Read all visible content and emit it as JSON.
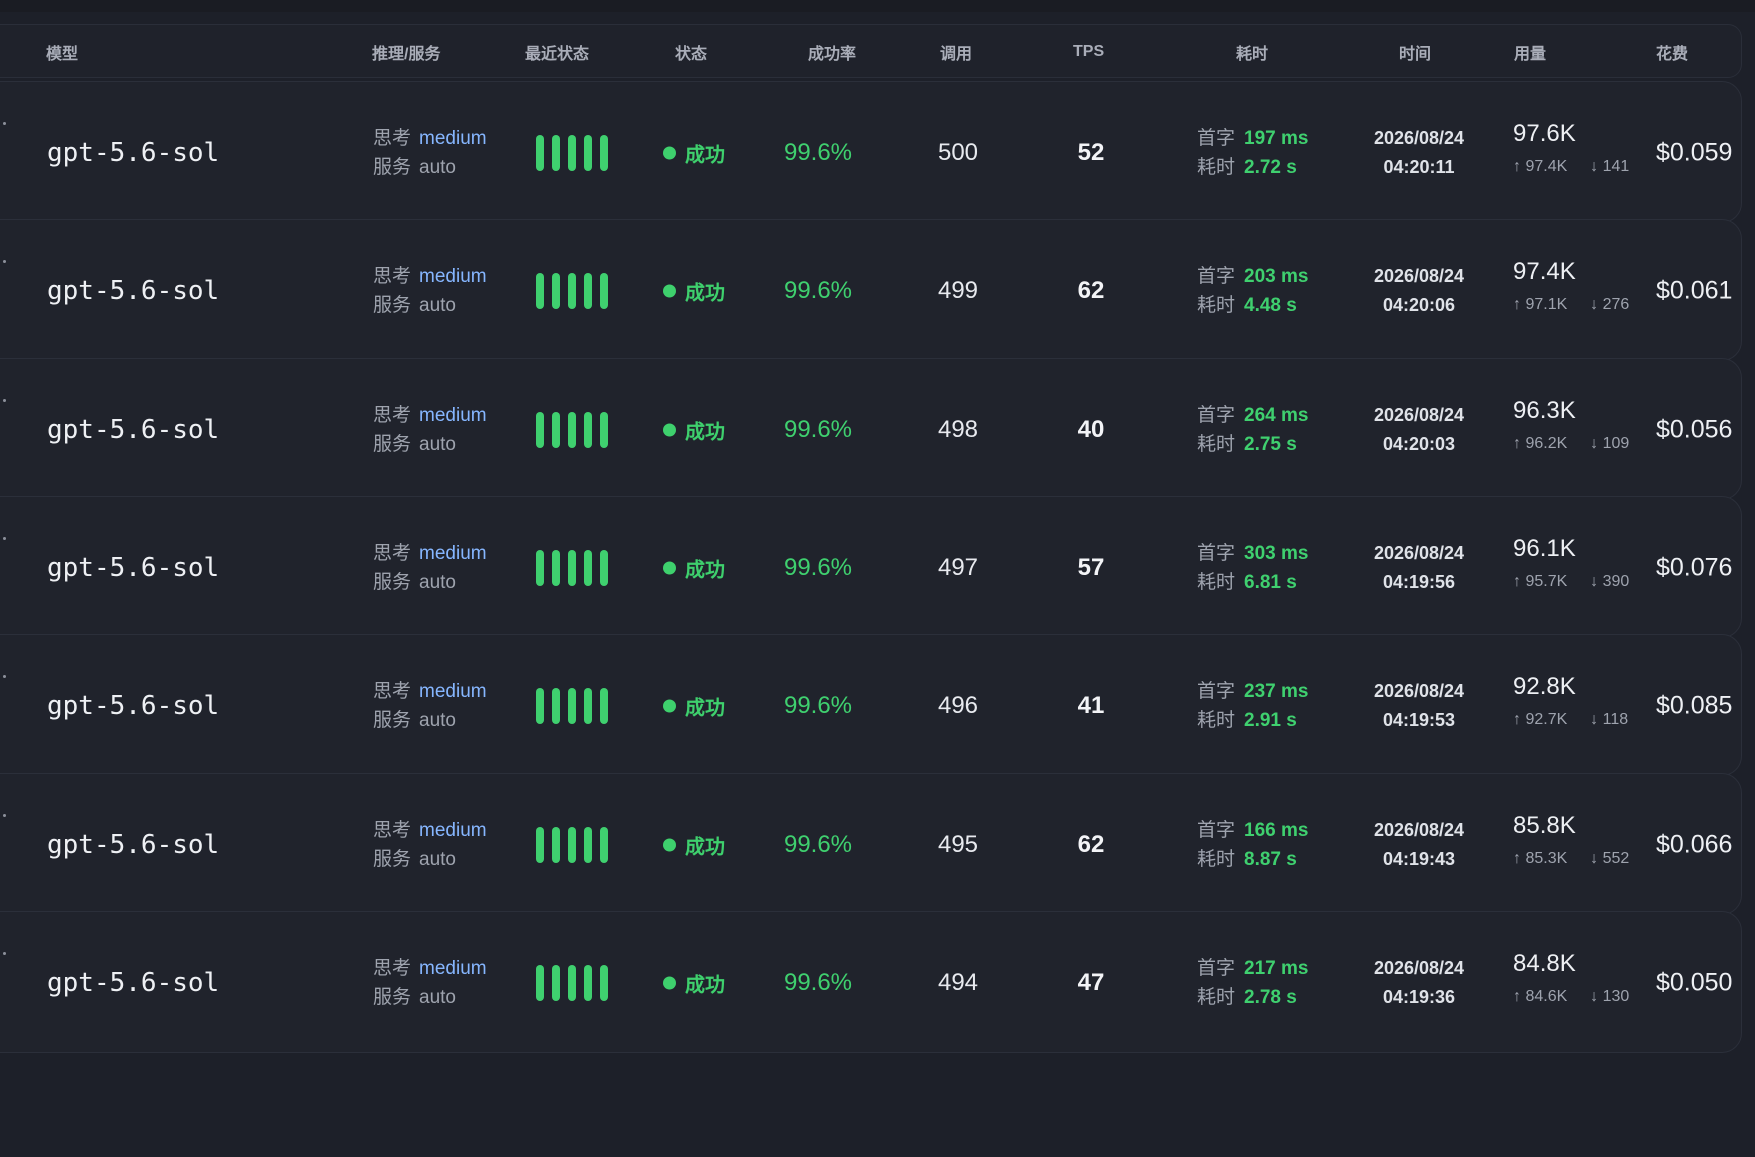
{
  "header": {
    "model": "模型",
    "reasoning_service": "推理/服务",
    "recent_status": "最近状态",
    "status": "状态",
    "success_rate": "成功率",
    "calls": "调用",
    "tps": "TPS",
    "latency": "耗时",
    "time": "时间",
    "usage": "用量",
    "cost": "花费"
  },
  "labels": {
    "thinking": "思考",
    "service": "服务",
    "first_token": "首字",
    "duration": "耗时",
    "success": "成功",
    "up_arrow": "↑",
    "down_arrow": "↓"
  },
  "colors": {
    "background": "#1d2029",
    "row_background": "#20232c",
    "success_green": "#3fd06f",
    "medium_blue": "#86b6ff",
    "muted_text": "#9ea3ae"
  },
  "rows": [
    {
      "model": "gpt-5.6-sol",
      "thinking": "medium",
      "service": "auto",
      "recent_bars": 5,
      "status": "成功",
      "success_rate": "99.6%",
      "calls": "500",
      "tps": "52",
      "first_token": "197 ms",
      "duration": "2.72 s",
      "date": "2026/08/24",
      "clock": "04:20:11",
      "usage_total": "97.6K",
      "usage_in": "97.4K",
      "usage_out": "141",
      "cost": "$0.059"
    },
    {
      "model": "gpt-5.6-sol",
      "thinking": "medium",
      "service": "auto",
      "recent_bars": 5,
      "status": "成功",
      "success_rate": "99.6%",
      "calls": "499",
      "tps": "62",
      "first_token": "203 ms",
      "duration": "4.48 s",
      "date": "2026/08/24",
      "clock": "04:20:06",
      "usage_total": "97.4K",
      "usage_in": "97.1K",
      "usage_out": "276",
      "cost": "$0.061"
    },
    {
      "model": "gpt-5.6-sol",
      "thinking": "medium",
      "service": "auto",
      "recent_bars": 5,
      "status": "成功",
      "success_rate": "99.6%",
      "calls": "498",
      "tps": "40",
      "first_token": "264 ms",
      "duration": "2.75 s",
      "date": "2026/08/24",
      "clock": "04:20:03",
      "usage_total": "96.3K",
      "usage_in": "96.2K",
      "usage_out": "109",
      "cost": "$0.056"
    },
    {
      "model": "gpt-5.6-sol",
      "thinking": "medium",
      "service": "auto",
      "recent_bars": 5,
      "status": "成功",
      "success_rate": "99.6%",
      "calls": "497",
      "tps": "57",
      "first_token": "303 ms",
      "duration": "6.81 s",
      "date": "2026/08/24",
      "clock": "04:19:56",
      "usage_total": "96.1K",
      "usage_in": "95.7K",
      "usage_out": "390",
      "cost": "$0.076"
    },
    {
      "model": "gpt-5.6-sol",
      "thinking": "medium",
      "service": "auto",
      "recent_bars": 5,
      "status": "成功",
      "success_rate": "99.6%",
      "calls": "496",
      "tps": "41",
      "first_token": "237 ms",
      "duration": "2.91 s",
      "date": "2026/08/24",
      "clock": "04:19:53",
      "usage_total": "92.8K",
      "usage_in": "92.7K",
      "usage_out": "118",
      "cost": "$0.085"
    },
    {
      "model": "gpt-5.6-sol",
      "thinking": "medium",
      "service": "auto",
      "recent_bars": 5,
      "status": "成功",
      "success_rate": "99.6%",
      "calls": "495",
      "tps": "62",
      "first_token": "166 ms",
      "duration": "8.87 s",
      "date": "2026/08/24",
      "clock": "04:19:43",
      "usage_total": "85.8K",
      "usage_in": "85.3K",
      "usage_out": "552",
      "cost": "$0.066"
    },
    {
      "model": "gpt-5.6-sol",
      "thinking": "medium",
      "service": "auto",
      "recent_bars": 5,
      "status": "成功",
      "success_rate": "99.6%",
      "calls": "494",
      "tps": "47",
      "first_token": "217 ms",
      "duration": "2.78 s",
      "date": "2026/08/24",
      "clock": "04:19:36",
      "usage_total": "84.8K",
      "usage_in": "84.6K",
      "usage_out": "130",
      "cost": "$0.050"
    }
  ]
}
